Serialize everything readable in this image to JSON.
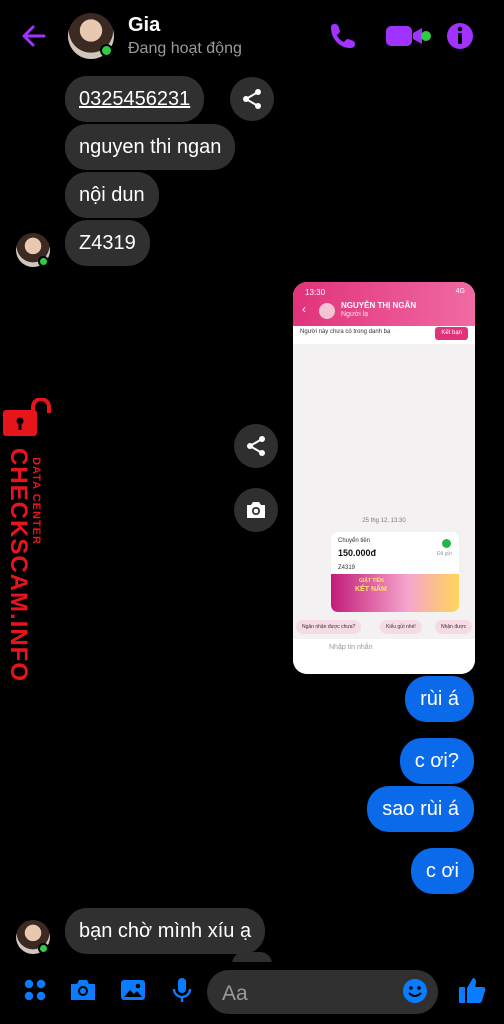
{
  "header": {
    "contact_name": "Gia",
    "status": "Đang hoạt động",
    "back_icon": "arrow-left-icon",
    "call_icon": "phone-icon",
    "video_icon": "video-camera-icon",
    "info_icon": "info-icon",
    "accent_color": "#a033ff"
  },
  "messages_in": [
    {
      "text": "0325456231"
    },
    {
      "text": "nguyen thi ngan"
    },
    {
      "text": "nội dun"
    },
    {
      "text": "Z4319"
    },
    {
      "text": "bạn chờ mình xíu ạ"
    }
  ],
  "messages_out": [
    {
      "text": "rùi á"
    },
    {
      "text": "c ơi?"
    },
    {
      "text": "sao rùi á"
    },
    {
      "text": "c ơi"
    }
  ],
  "shared_screenshot": {
    "time": "13:30",
    "battery": "4G",
    "name": "NGUYỄN THỊ NGÂN",
    "sub": "Người lạ",
    "not_in_contacts": "Người này chưa có trong danh bạ",
    "add_friend": "Kết bạn",
    "date": "25 thg 12, 13:30",
    "card_title": "Chuyển tiền",
    "amount": "150.000đ",
    "done": "Đã gửi",
    "ref": "Z4319",
    "promo_line1": "GIẬT TIỀN",
    "promo_line2": "KẾT NĂM",
    "chips": [
      "Ngân nhận được chưa?",
      "Kiểu gửi nhé!",
      "Nhận được"
    ],
    "input_placeholder": "Nhập tin nhắn"
  },
  "watermark": {
    "main": "CHECKSCAM.INFO",
    "sub": "DATA CENTER",
    "color": "#e8141b"
  },
  "composer": {
    "placeholder": "Aa",
    "icons": [
      "apps-icon",
      "camera-icon",
      "image-icon",
      "microphone-icon",
      "emoji-icon",
      "like-icon"
    ],
    "accent_color": "#0a7cff"
  }
}
